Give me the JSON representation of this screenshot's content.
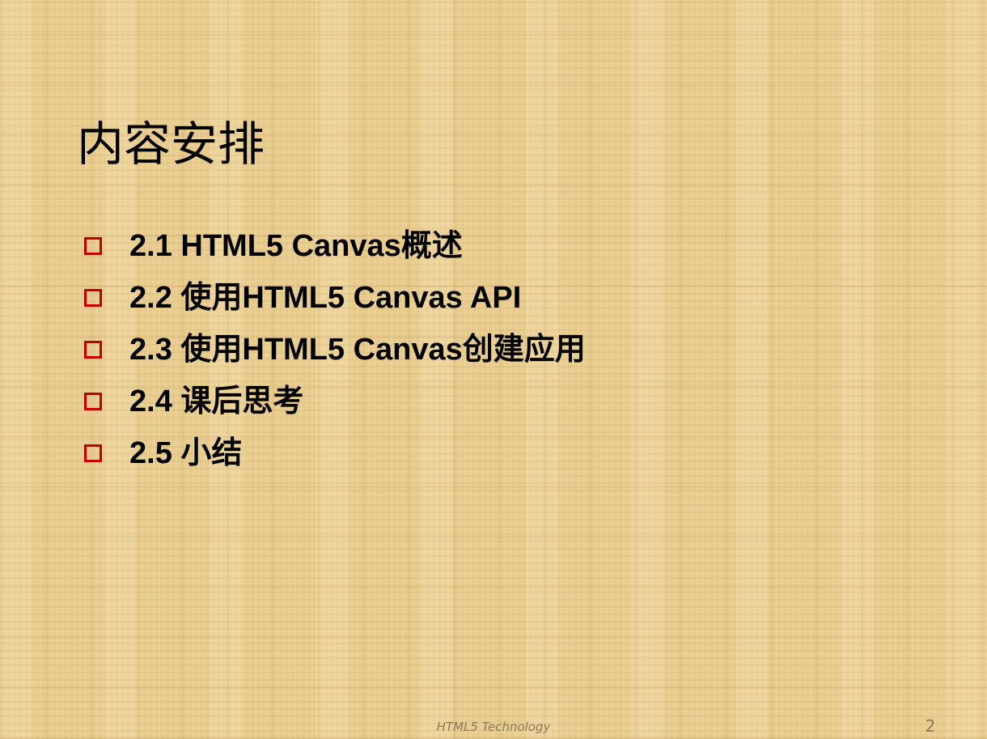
{
  "slide": {
    "title": "内容安排",
    "items": [
      {
        "label": "2.1 HTML5 Canvas概述"
      },
      {
        "label": "2.2 使用HTML5 Canvas API"
      },
      {
        "label": "2.3 使用HTML5 Canvas创建应用"
      },
      {
        "label": "2.4 课后思考"
      },
      {
        "label": "2.5 小结"
      }
    ],
    "footer": "HTML5 Technology",
    "page_number": "2"
  },
  "colors": {
    "background": "#e8cc8d",
    "bullet": "#c00000",
    "text": "#000000",
    "footer": "#8a7a5a"
  },
  "icons": {
    "bullet": "hollow-square-bullet-icon"
  }
}
